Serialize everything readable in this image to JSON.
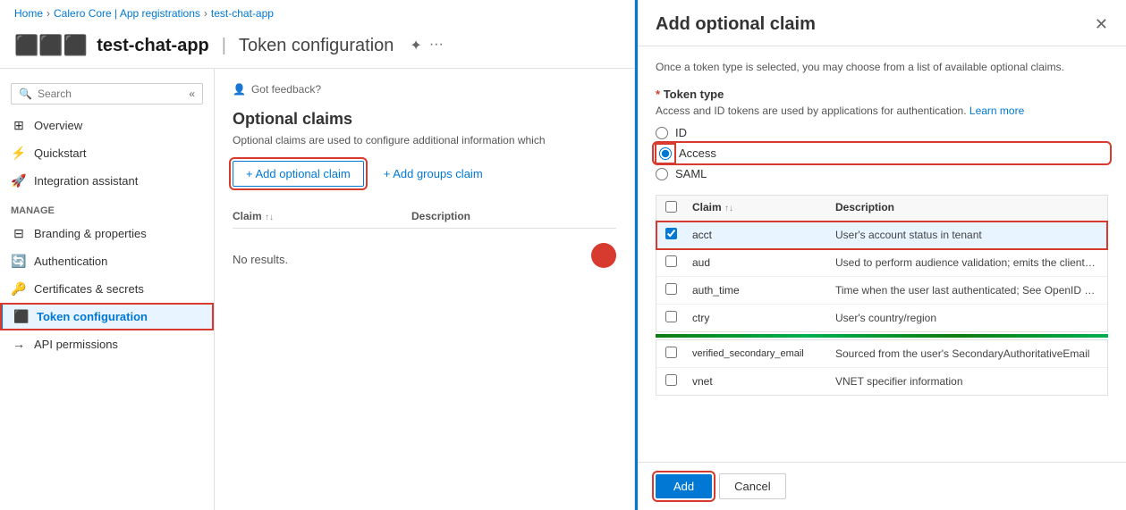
{
  "breadcrumb": {
    "home": "Home",
    "app_registrations": "Calero Core | App registrations",
    "current": "test-chat-app"
  },
  "header": {
    "icon": "|||",
    "app_name": "test-chat-app",
    "separator": "|",
    "page_title": "Token configuration",
    "pin_icon": "✦",
    "more_icon": "···"
  },
  "sidebar": {
    "search_placeholder": "Search",
    "collapse_label": "«",
    "nav_items": [
      {
        "id": "overview",
        "label": "Overview",
        "icon": "⊞"
      },
      {
        "id": "quickstart",
        "label": "Quickstart",
        "icon": "⚡"
      },
      {
        "id": "integration",
        "label": "Integration assistant",
        "icon": "🚀"
      }
    ],
    "manage_label": "Manage",
    "manage_items": [
      {
        "id": "branding",
        "label": "Branding & properties",
        "icon": "⊟"
      },
      {
        "id": "authentication",
        "label": "Authentication",
        "icon": "🔄"
      },
      {
        "id": "certificates",
        "label": "Certificates & secrets",
        "icon": "🔑"
      },
      {
        "id": "token",
        "label": "Token configuration",
        "icon": "|||",
        "active": true
      },
      {
        "id": "api",
        "label": "API permissions",
        "icon": "→"
      }
    ]
  },
  "content": {
    "feedback_icon": "👤",
    "feedback_text": "Got feedback?",
    "title": "Optional claims",
    "description": "Optional claims are used to configure additional information which",
    "add_claim_label": "+ Add optional claim",
    "add_groups_label": "+ Add groups claim",
    "table_headers": {
      "claim": "Claim",
      "description": "Description"
    },
    "no_results": "No results."
  },
  "modal": {
    "title": "Add optional claim",
    "close_icon": "✕",
    "intro": "Once a token type is selected, you may choose from a list of available optional claims.",
    "token_type_label": "Token type",
    "token_type_req": "*",
    "token_type_desc": "Access and ID tokens are used by applications for authentication.",
    "learn_more_text": "Learn more",
    "radio_options": [
      {
        "id": "id",
        "label": "ID",
        "checked": false
      },
      {
        "id": "access",
        "label": "Access",
        "checked": true
      },
      {
        "id": "saml",
        "label": "SAML",
        "checked": false
      }
    ],
    "table_headers": {
      "check": "",
      "claim": "Claim",
      "description": "Description"
    },
    "claims": [
      {
        "id": "acct",
        "label": "acct",
        "description": "User's account status in tenant",
        "checked": true,
        "highlighted": true
      },
      {
        "id": "aud",
        "label": "aud",
        "description": "Used to perform audience validation; emits the client ID...",
        "checked": false
      },
      {
        "id": "auth_time",
        "label": "auth_time",
        "description": "Time when the user last authenticated; See OpenID Con...",
        "checked": false
      },
      {
        "id": "ctry",
        "label": "ctry",
        "description": "User's country/region",
        "checked": false
      }
    ],
    "bottom_claims": [
      {
        "id": "verified_secondary_email",
        "label": "verified_secondary_email",
        "description": "Sourced from the user's SecondaryAuthoritativeEmail",
        "checked": false
      },
      {
        "id": "vnet",
        "label": "vnet",
        "description": "VNET specifier information",
        "checked": false
      }
    ],
    "add_button": "Add",
    "cancel_button": "Cancel"
  }
}
